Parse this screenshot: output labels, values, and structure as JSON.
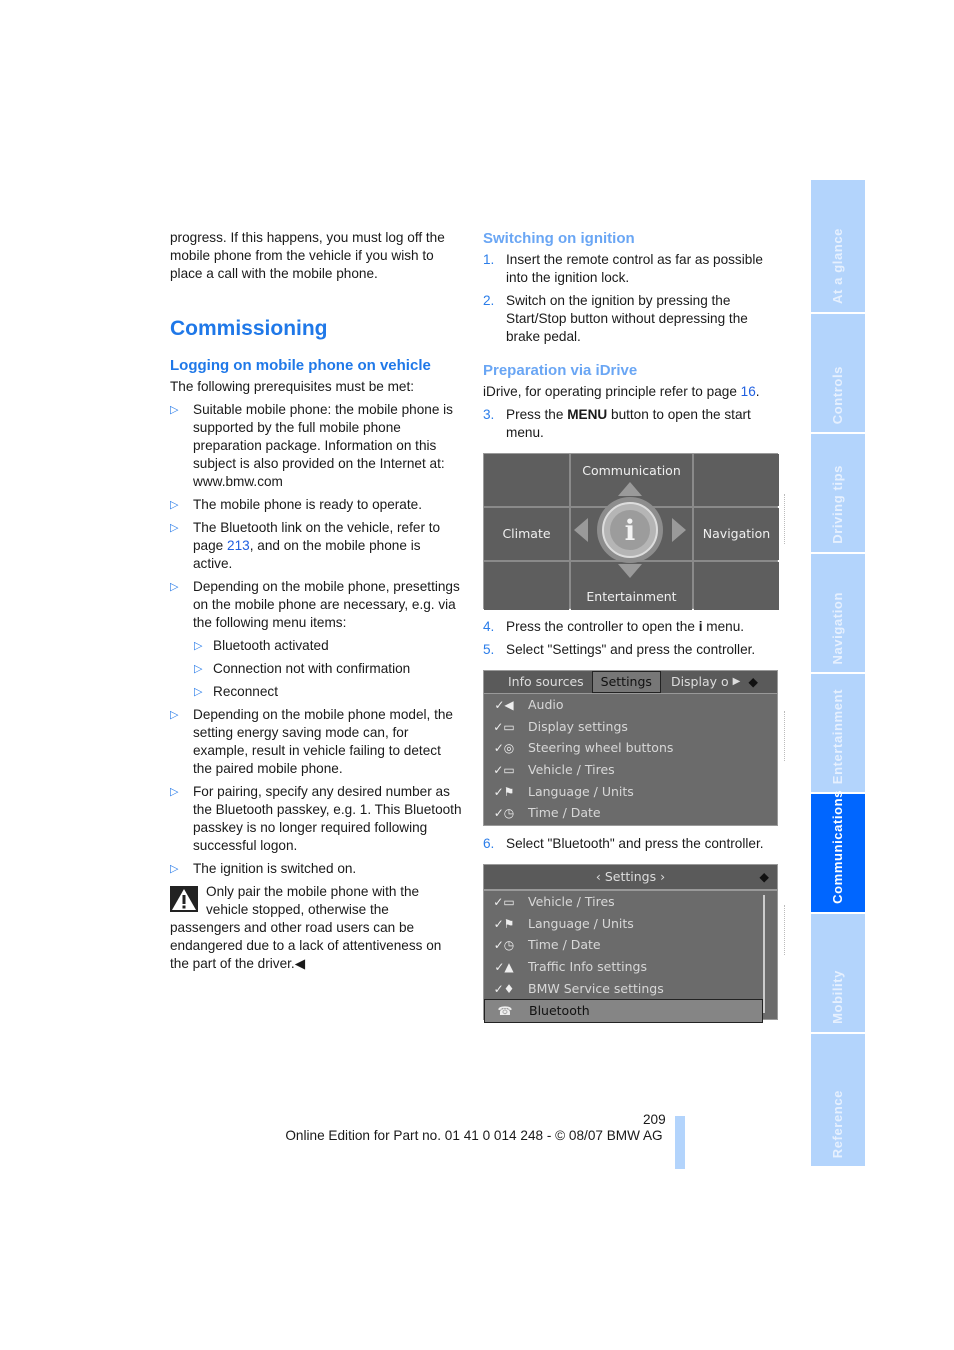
{
  "left": {
    "intro": "progress. If this happens, you must log off the mobile phone from the vehicle if you wish to place a call with the mobile phone.",
    "heading": "Commissioning",
    "subheading": "Logging on mobile phone on vehicle",
    "prereq": "The following prerequisites must be met:",
    "bullet_icon": "triangle-right",
    "bullets": [
      "Suitable mobile phone: the mobile phone is supported by the full mobile phone preparation package. Information on this subject is also provided on the Internet at: www.bmw.com",
      "The mobile phone is ready to operate."
    ],
    "bluetooth_bullet": {
      "before": "The Bluetooth link on the vehicle, refer to page ",
      "link": "213",
      "after": ", and on the mobile phone is active."
    },
    "presettings": "Depending on the mobile phone, presettings on the mobile phone are necessary, e.g. via the following menu items:",
    "sub_items": [
      "Bluetooth activated",
      "Connection not with confirmation",
      "Reconnect"
    ],
    "bullets2": [
      "Depending on the mobile phone model, the setting energy saving mode can, for example, result in vehicle failing to detect the paired mobile phone.",
      "For pairing, specify any desired number as the Bluetooth passkey, e.g. 1. This Bluetooth passkey is no longer required following successful logon.",
      "The ignition is switched on."
    ],
    "warning": "Only pair the mobile phone with the vehicle stopped, otherwise the passengers and other road users can be endangered due to a lack of attentiveness on the part of the driver.",
    "end_mark": "◀"
  },
  "right": {
    "heading1": "Switching on ignition",
    "steps1": [
      {
        "n": "1.",
        "text": "Insert the remote control as far as possible into the ignition lock."
      },
      {
        "n": "2.",
        "text": "Switch on the ignition by pressing the Start/Stop button without depressing the brake pedal."
      }
    ],
    "heading2": "Preparation via iDrive",
    "idrive": {
      "before": "iDrive, for operating principle refer to page ",
      "link": "16",
      "after": "."
    },
    "step3": {
      "n": "3.",
      "before": "Press the ",
      "bold": "MENU",
      "after": " button to open the start menu."
    },
    "screen1": {
      "top": "Communication",
      "left": "Climate",
      "right": "Navigation",
      "bottom": "Entertainment",
      "center_icon": "info-icon"
    },
    "step4": {
      "n": "4.",
      "before": "Press the controller to open the ",
      "icon": "i",
      "after": " menu."
    },
    "step5": {
      "n": "5.",
      "text": "Select \"Settings\" and press the controller."
    },
    "screen2": {
      "tabs": [
        "Info sources",
        "Settings",
        "Display o"
      ],
      "active_tab": "Settings",
      "items": [
        {
          "icon": "audio-icon",
          "label": "Audio"
        },
        {
          "icon": "display-icon",
          "label": "Display settings"
        },
        {
          "icon": "steering-wheel-icon",
          "label": "Steering wheel buttons"
        },
        {
          "icon": "car-icon",
          "label": "Vehicle / Tires"
        },
        {
          "icon": "flag-icon",
          "label": "Language / Units"
        },
        {
          "icon": "clock-icon",
          "label": "Time / Date"
        }
      ]
    },
    "step6": {
      "n": "6.",
      "text": "Select \"Bluetooth\" and press the controller."
    },
    "screen3": {
      "title": "‹ Settings ›",
      "items": [
        {
          "icon": "car-icon",
          "label": "Vehicle / Tires"
        },
        {
          "icon": "flag-icon",
          "label": "Language / Units"
        },
        {
          "icon": "clock-icon",
          "label": "Time / Date"
        },
        {
          "icon": "warning-icon",
          "label": "Traffic Info settings"
        },
        {
          "icon": "service-icon",
          "label": "BMW Service settings"
        },
        {
          "icon": "phone-icon",
          "label": "Bluetooth"
        }
      ],
      "selected": "Bluetooth"
    }
  },
  "tabs": [
    {
      "label": "At a glance",
      "active": false
    },
    {
      "label": "Controls",
      "active": false
    },
    {
      "label": "Driving tips",
      "active": false
    },
    {
      "label": "Navigation",
      "active": false
    },
    {
      "label": "Entertainment",
      "active": false
    },
    {
      "label": "Communications",
      "active": true
    },
    {
      "label": "Mobility",
      "active": false
    },
    {
      "label": "Reference",
      "active": false
    }
  ],
  "footer": {
    "page": "209",
    "text": "Online Edition for Part no. 01 41 0 014 248 - © 08/07 BMW AG"
  },
  "colors": {
    "heading": "#1f78e8",
    "heading_light": "#6aa6f4",
    "tab": "#b3d4fc",
    "tab_active": "#0066ff"
  }
}
